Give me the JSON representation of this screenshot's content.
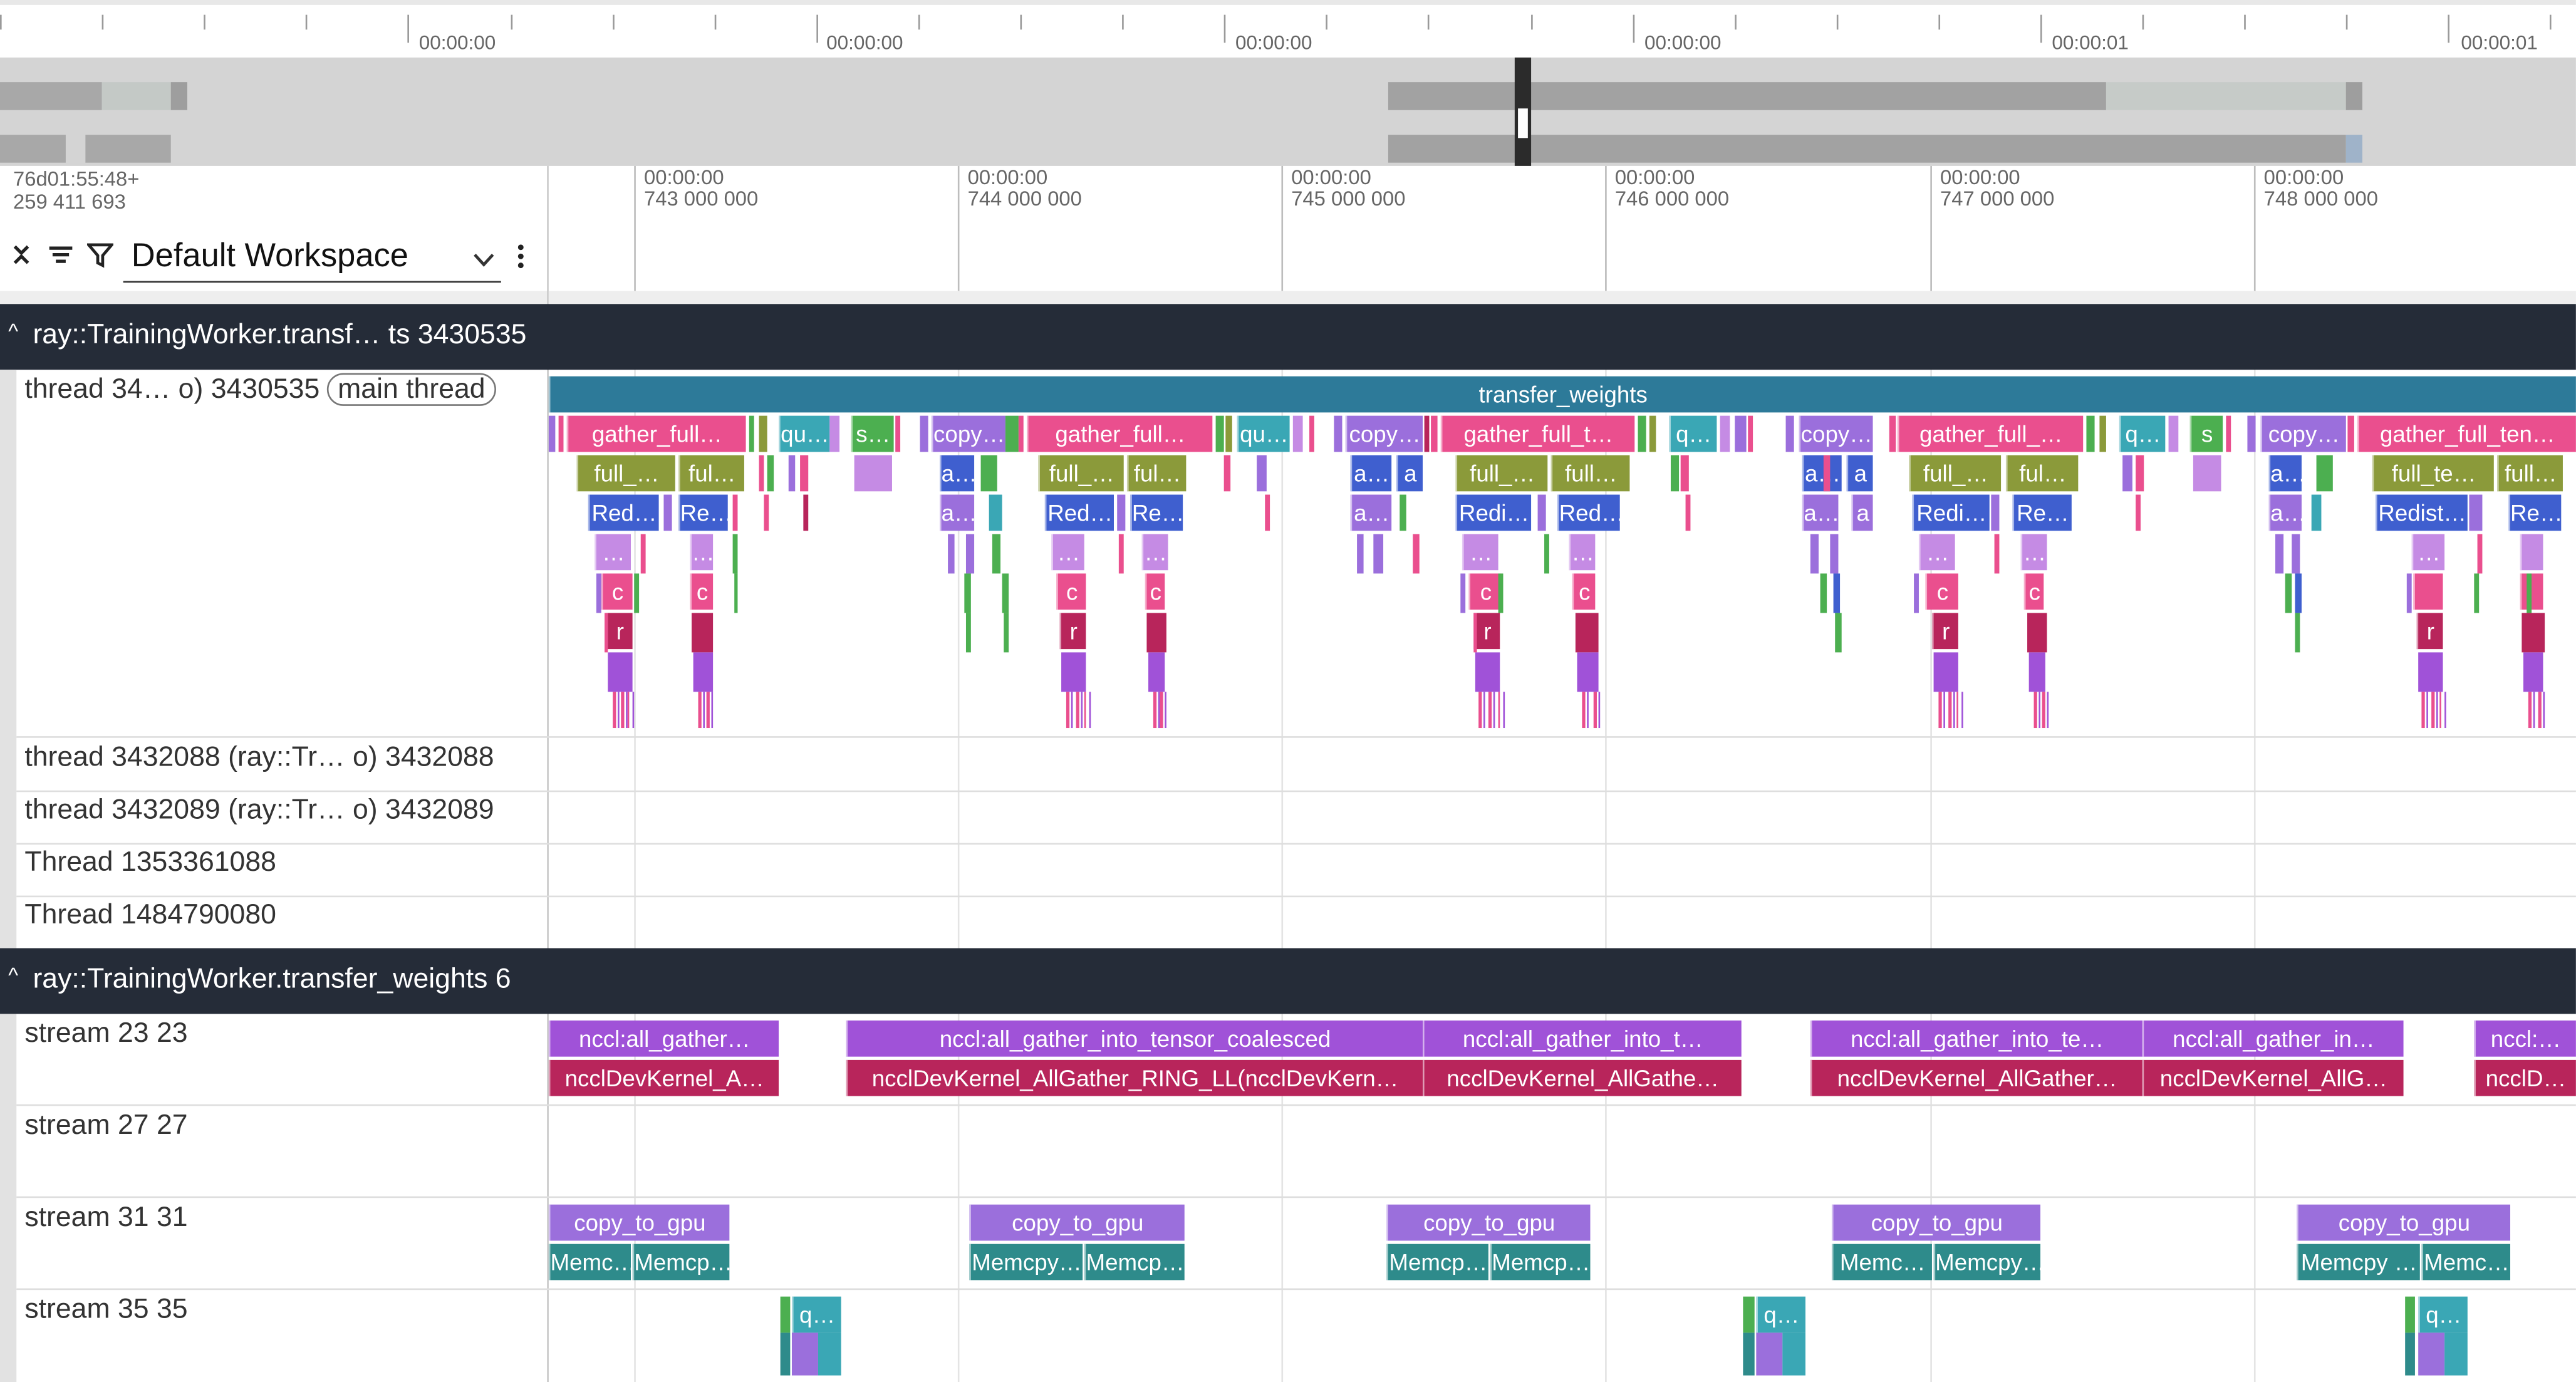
{
  "timeline_overview": {
    "labels": [
      "00:00:00",
      "00:00:00",
      "00:00:00",
      "00:00:00",
      "00:00:01",
      "00:00:01"
    ]
  },
  "ruler": {
    "origin": [
      "76d01:55:48+",
      "259 411 693"
    ],
    "ticks": [
      {
        "time": "00:00:00",
        "ns": "743 000 000"
      },
      {
        "time": "00:00:00",
        "ns": "744 000 000"
      },
      {
        "time": "00:00:00",
        "ns": "745 000 000"
      },
      {
        "time": "00:00:00",
        "ns": "746 000 000"
      },
      {
        "time": "00:00:00",
        "ns": "747 000 000"
      },
      {
        "time": "00:00:00",
        "ns": "748 000 000"
      }
    ]
  },
  "workspace": {
    "name": "Default Workspace",
    "icons": [
      "collapse-all-icon",
      "sort-icon",
      "filter-icon",
      "chevron-down-icon",
      "more-vert-icon"
    ]
  },
  "groups": [
    {
      "title": "ray::TrainingWorker.transf…  ts 3430535",
      "tracks": [
        {
          "label": "thread 34… o) 3430535",
          "tag": "main thread"
        },
        {
          "label": "thread 3432088 (ray::Tr… o) 3432088"
        },
        {
          "label": "thread 3432089 (ray::Tr… o) 3432089"
        },
        {
          "label": "Thread 1353361088"
        },
        {
          "label": "Thread 1484790080"
        }
      ]
    },
    {
      "title": "ray::TrainingWorker.transfer_weights 6",
      "tracks": [
        {
          "label": "stream 23 23"
        },
        {
          "label": "stream 27 27"
        },
        {
          "label": "stream 31 31"
        },
        {
          "label": "stream 35 35"
        }
      ]
    }
  ],
  "colors": {
    "pink": "#ea4f8e",
    "olive": "#8b9a3a",
    "blue": "#3f5fcf",
    "violet": "#9b6fdc",
    "teal": "#3aa7b5",
    "green": "#4caf50",
    "purple": "#a052d8",
    "crimson": "#b8255b",
    "sea": "#2e8b8b",
    "root": "#2d7a99",
    "lavender": "#c58be4"
  },
  "slices": {
    "root": "transfer_weights",
    "main_l1": [
      "gather_full…",
      "qu…",
      "s…",
      "copy…",
      "gather_full…",
      "qu…",
      "copy…",
      "gather_full_t…",
      "q…",
      "copy…",
      "gather_full_…",
      "q…",
      "s",
      "copy…",
      "gather_full_ten…"
    ],
    "main_l2": [
      "full_…",
      "ful…",
      "a…",
      "full_…",
      "ful…",
      "a…",
      "a",
      "full_…",
      "full…",
      "a…",
      "a",
      "full_…",
      "ful…",
      "a…",
      "full_te…",
      "full…"
    ],
    "main_l3": [
      "Red…",
      "Re…",
      "a…",
      "Red…",
      "Re…",
      "a…",
      "Redi…",
      "Red…",
      "a…",
      "a",
      "Redi…",
      "Re…",
      "a…",
      "Redist…",
      "Re…"
    ],
    "main_l4": [
      "…",
      "…",
      "…",
      "…",
      "…",
      "…",
      "…",
      "…",
      "…"
    ],
    "main_l5": [
      "c",
      "c",
      "c",
      "c",
      "c",
      "c",
      "c",
      "c"
    ],
    "main_l6": [
      "r",
      "r",
      "r",
      "r",
      "r"
    ],
    "stream23_l1": [
      "nccl:all_gather…",
      "nccl:all_gather_into_tensor_coalesced",
      "nccl:all_gather_into_t…",
      "nccl:all_gather_into_te…",
      "nccl:all_gather_in…",
      "nccl:…"
    ],
    "stream23_l2": [
      "ncclDevKernel_A…",
      "ncclDevKernel_AllGather_RING_LL(ncclDevKern…",
      "ncclDevKernel_AllGathe…",
      "ncclDevKernel_AllGather…",
      "ncclDevKernel_AllG…",
      "ncclD…"
    ],
    "stream31_l1": [
      "copy_to_gpu",
      "copy_to_gpu",
      "copy_to_gpu",
      "copy_to_gpu",
      "copy_to_gpu"
    ],
    "stream31_l2": [
      "Memc…",
      "Memcp…",
      "Memcpy…",
      "Memcp…",
      "Memcp…",
      "Memcp…",
      "Memc…",
      "Memcpy…",
      "Memcpy …",
      "Memc…"
    ],
    "stream35": [
      "q…",
      "q…",
      "q…"
    ]
  }
}
